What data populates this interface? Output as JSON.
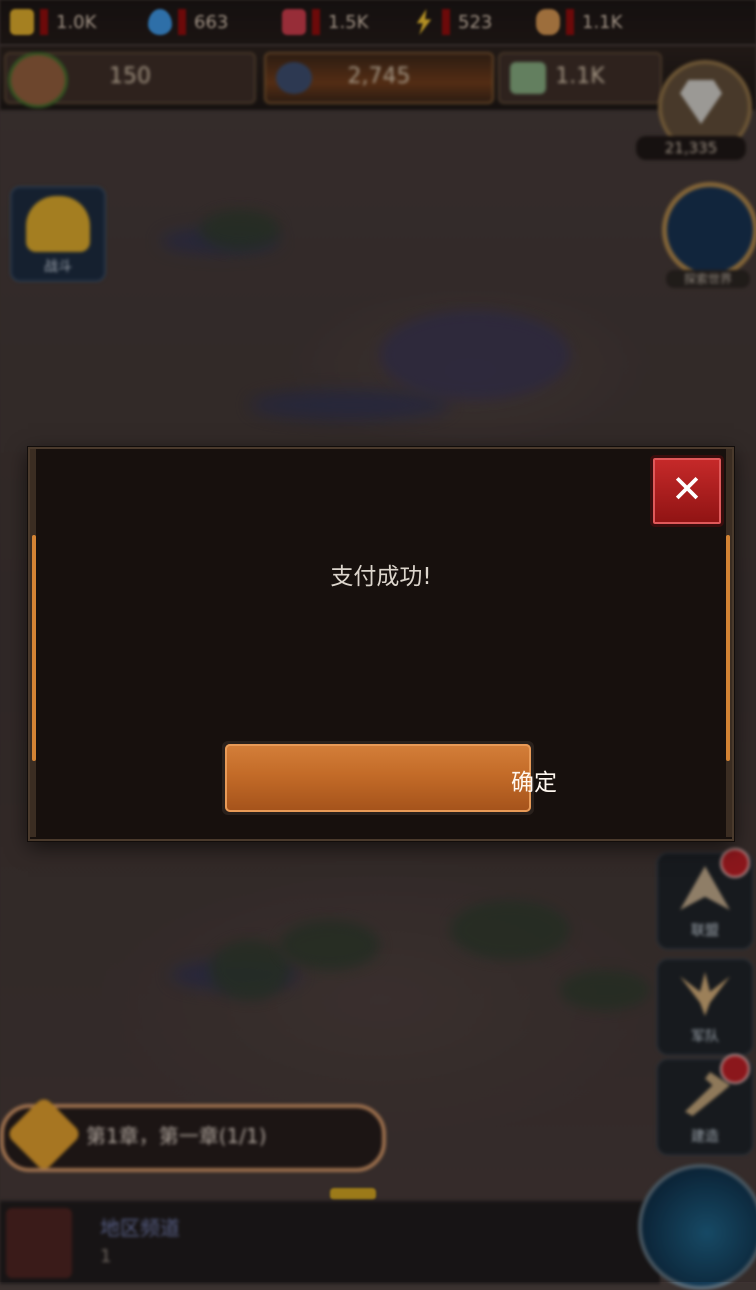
{
  "resources": [
    {
      "icon": "gold-bar-icon",
      "value": "1.0K",
      "color": "#d4a52b"
    },
    {
      "icon": "water-drop-icon",
      "value": "663",
      "color": "#3b8fd8"
    },
    {
      "icon": "meat-icon",
      "value": "1.5K",
      "color": "#c23a48"
    },
    {
      "icon": "lightning-icon",
      "value": "523",
      "color": "#e4b72f"
    },
    {
      "icon": "bread-icon",
      "value": "1.1K",
      "color": "#c98d4d"
    }
  ],
  "stats": {
    "population": {
      "icon": "potion-icon",
      "value": "150"
    },
    "power": {
      "icon": "crossed-swords-icon",
      "value": "2,745"
    },
    "money": {
      "icon": "cash-icon",
      "value": "1.1K"
    }
  },
  "gems": {
    "icon": "diamond-icon",
    "value": "21,335"
  },
  "left_button": {
    "icon": "helmet-icon",
    "label": "战斗"
  },
  "globe_button": {
    "icon": "globe-icon",
    "label": "探索世界"
  },
  "side_buttons": [
    {
      "icon": "wings-icon",
      "label": "联盟",
      "badge": true
    },
    {
      "icon": "eagle-icon",
      "label": "军队",
      "badge": false
    },
    {
      "icon": "hammer-icon",
      "label": "建造",
      "badge": true
    }
  ],
  "quest": {
    "icon": "checkmark-badge-icon",
    "text": "第1章，第一章(1/1)"
  },
  "chat": {
    "name": "地区频道",
    "message": "1"
  },
  "dialog": {
    "message": "支付成功!",
    "confirm_label": "确定",
    "close_symbol": "✕"
  }
}
